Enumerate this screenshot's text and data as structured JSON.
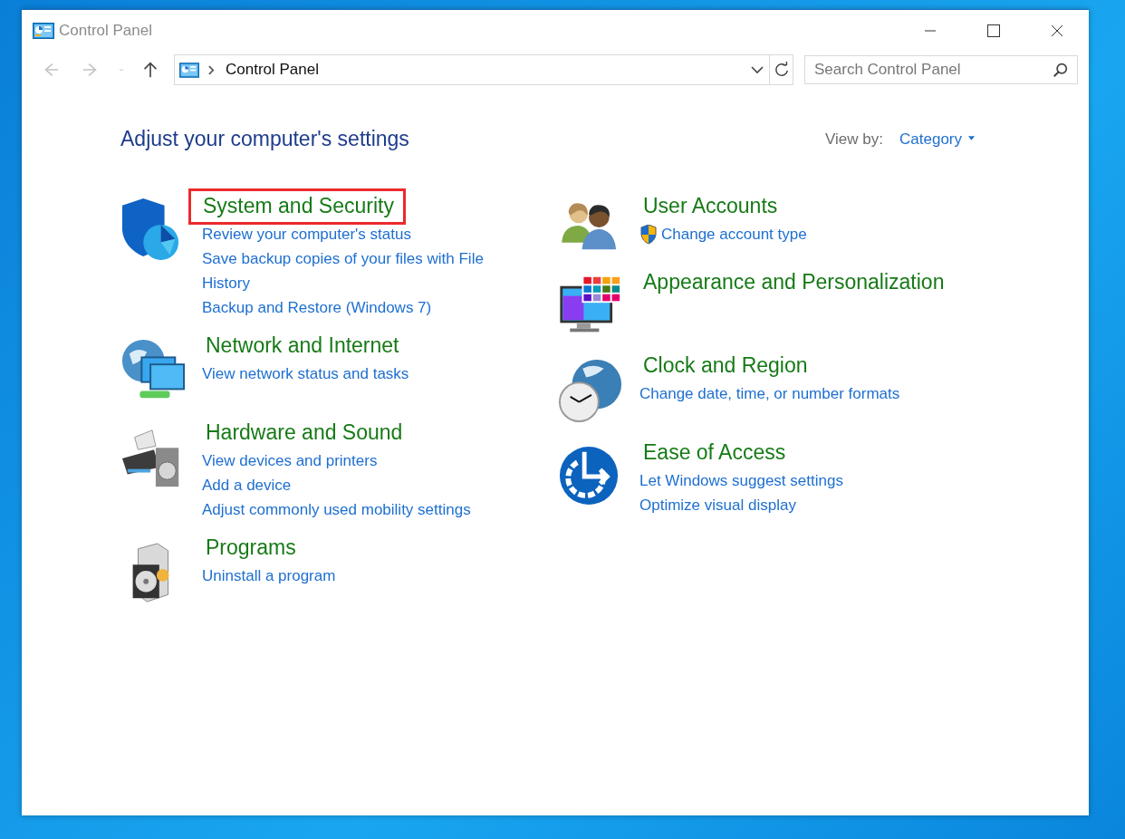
{
  "window": {
    "title": "Control Panel"
  },
  "nav_buttons": [
    {
      "kind": "back",
      "disabled": true
    },
    {
      "kind": "forward",
      "disabled": true
    },
    {
      "kind": "recent",
      "disabled": true
    },
    {
      "kind": "up",
      "disabled": false
    }
  ],
  "address_bar": {
    "path": "Control Panel"
  },
  "search": {
    "placeholder": "Search Control Panel"
  },
  "heading": "Adjust your computer's settings",
  "view_by": {
    "label": "View by:",
    "value": "Category"
  },
  "columns": [
    [
      {
        "title": "System and Security",
        "highlighted": true,
        "links": [
          {
            "text": "Review your computer's status",
            "kind": "link"
          },
          {
            "text": "Save backup copies of your files with File History",
            "kind": "link"
          },
          {
            "text": "Backup and Restore (Windows 7)",
            "kind": "link"
          }
        ]
      },
      {
        "title": "Network and Internet",
        "highlighted": false,
        "links": [
          {
            "text": "View network status and tasks",
            "kind": "link"
          }
        ]
      },
      {
        "title": "Hardware and Sound",
        "highlighted": false,
        "links": [
          {
            "text": "View devices and printers",
            "kind": "link"
          },
          {
            "text": "Add a device",
            "kind": "link"
          },
          {
            "text": "Adjust commonly used mobility settings",
            "kind": "link"
          }
        ]
      },
      {
        "title": "Programs",
        "highlighted": false,
        "links": [
          {
            "text": "Uninstall a program",
            "kind": "link"
          }
        ]
      }
    ],
    [
      {
        "title": "User Accounts",
        "highlighted": false,
        "links": [
          {
            "text": "Change account type",
            "kind": "admin-link"
          }
        ]
      },
      {
        "title": "Appearance and Personalization",
        "highlighted": false
      },
      {
        "title": "Clock and Region",
        "highlighted": false,
        "links": [
          {
            "text": "Change date, time, or number formats",
            "kind": "link"
          }
        ]
      },
      {
        "title": "Ease of Access",
        "highlighted": false,
        "links": [
          {
            "text": "Let Windows suggest settings",
            "kind": "link"
          },
          {
            "text": "Optimize visual display",
            "kind": "link"
          }
        ]
      }
    ]
  ]
}
